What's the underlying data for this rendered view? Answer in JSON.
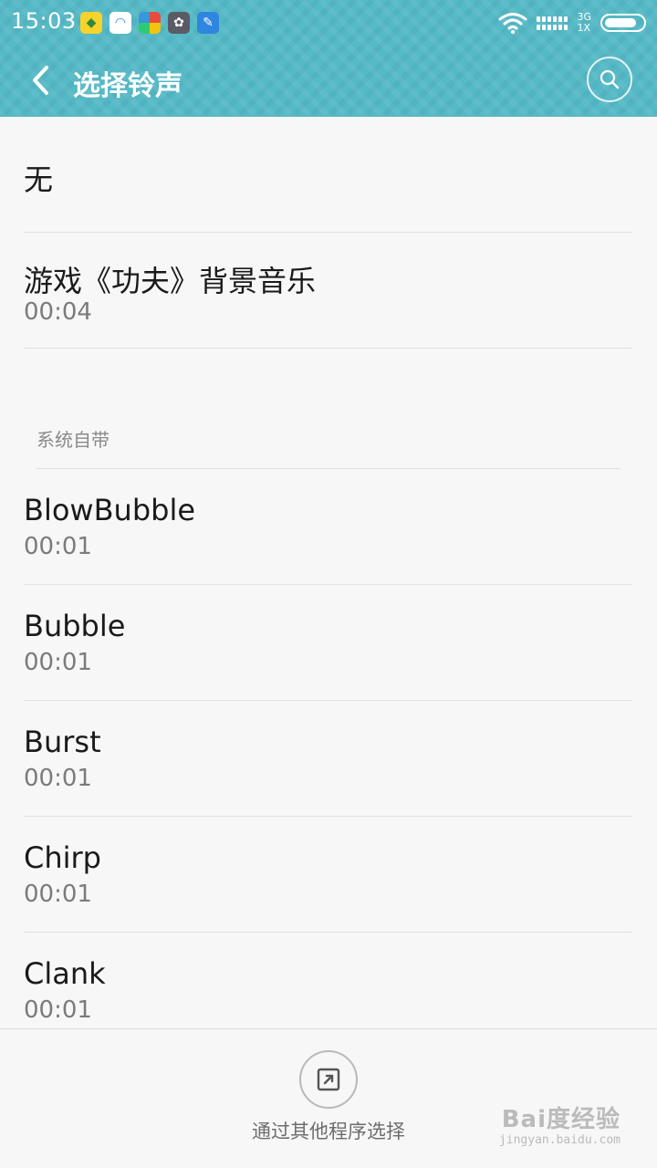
{
  "status_bar": {
    "time": "15:03",
    "network_type_top": "3G",
    "network_type_bottom": "1X",
    "battery_level": 0.85
  },
  "header": {
    "title": "选择铃声"
  },
  "ringtones": [
    {
      "title": "无"
    },
    {
      "title": "游戏《功夫》背景音乐",
      "duration": "00:04"
    }
  ],
  "section": {
    "label": "系统自带"
  },
  "system_ringtones": [
    {
      "title": "BlowBubble",
      "duration": "00:01"
    },
    {
      "title": "Bubble",
      "duration": "00:01"
    },
    {
      "title": "Burst",
      "duration": "00:01"
    },
    {
      "title": "Chirp",
      "duration": "00:01"
    },
    {
      "title": "Clank",
      "duration": "00:01"
    }
  ],
  "bottom": {
    "choose_label": "通过其他程序选择"
  },
  "watermark": {
    "main": "Bai度经验",
    "sub": "jingyan.baidu.com"
  },
  "colors": {
    "header": "#55b9c6",
    "background": "#f7f7f7"
  }
}
